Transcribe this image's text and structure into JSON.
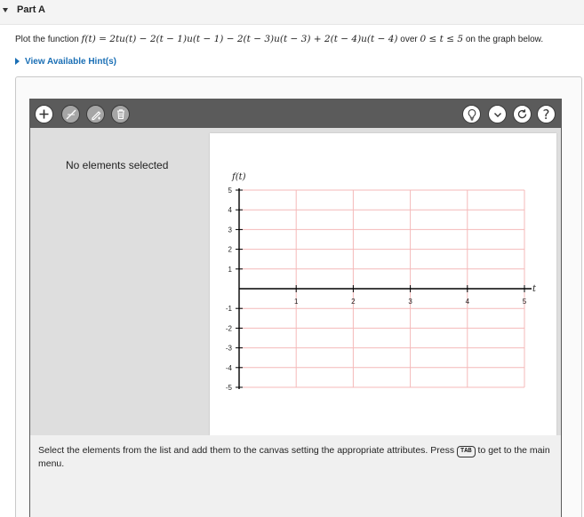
{
  "part": {
    "title": "Part A"
  },
  "prompt": {
    "lead": "Plot the function ",
    "function": "f(t) = 2tu(t) − 2(t − 1)u(t − 1) − 2(t − 3)u(t − 3) + 2(t − 4)u(t − 4)",
    "mid": " over ",
    "range": "0 ≤ t ≤ 5",
    "tail": " on the graph below."
  },
  "hint": {
    "label": "View Available Hint(s)"
  },
  "toolbar": {
    "left_icons": [
      "add-icon",
      "line-tool-icon",
      "edit-tool-icon",
      "trash-icon"
    ],
    "right_icons": [
      "lightbulb-icon",
      "chevron-down-icon",
      "reset-icon",
      "help-icon"
    ],
    "help_label": "?"
  },
  "side_panel": {
    "status": "No elements selected"
  },
  "graph": {
    "y_axis_label": "f(t)",
    "x_axis_label": "t",
    "x_ticks": [
      "1",
      "2",
      "3",
      "4",
      "5"
    ],
    "y_ticks": [
      "5",
      "4",
      "3",
      "2",
      "1",
      "-1",
      "-2",
      "-3",
      "-4",
      "-5"
    ],
    "x_range": [
      0,
      5
    ],
    "y_range": [
      -5,
      5
    ],
    "grid_color": "#f4b9b9",
    "axis_color": "#000000"
  },
  "instructions": {
    "before": "Select the elements from the list and add them to the canvas setting the appropriate attributes. Press ",
    "key": "TAB",
    "after": " to get to the main menu."
  }
}
